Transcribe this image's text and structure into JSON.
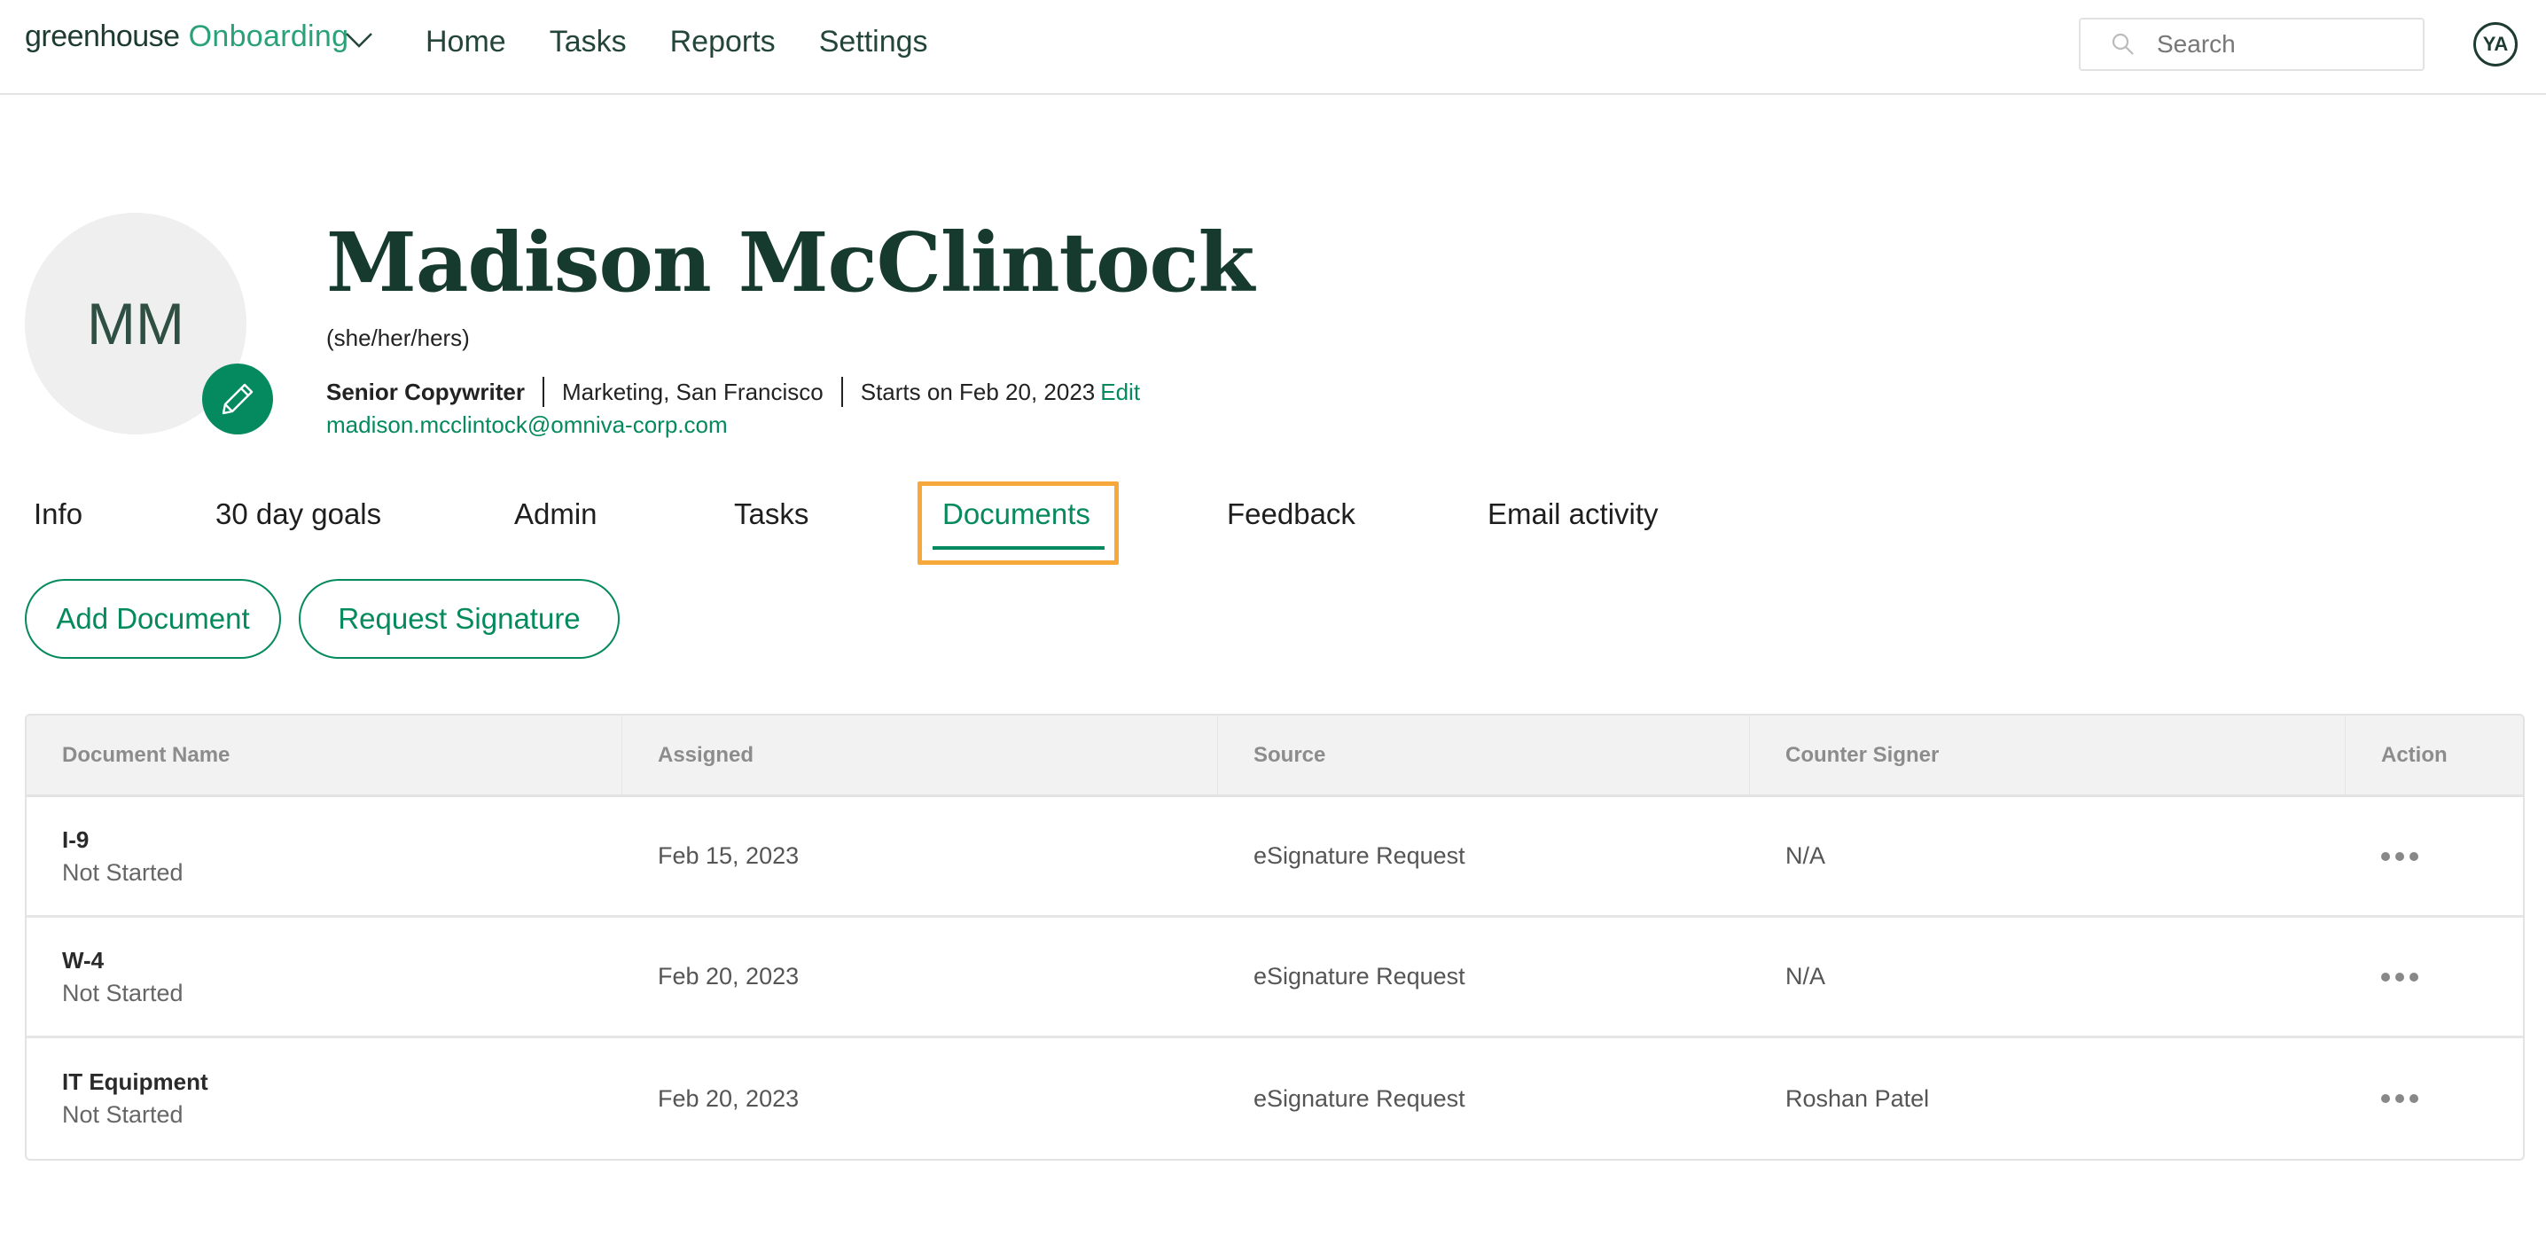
{
  "app": {
    "brand_primary": "greenhouse",
    "brand_secondary": "Onboarding",
    "brand_color": "#2aa178",
    "accent_color": "#048a5e",
    "highlight_color": "#f6a83a"
  },
  "nav": {
    "links": [
      "Home",
      "Tasks",
      "Reports",
      "Settings"
    ],
    "search_placeholder": "Search",
    "search_icon": "search-icon",
    "user_initials": "YA"
  },
  "profile": {
    "initials": "MM",
    "name": "Madison McClintock",
    "pronouns": "(she/her/hers)",
    "job_title": "Senior Copywriter",
    "department_location": "Marketing, San Francisco",
    "start_date": "Starts on Feb 20, 2023",
    "edit_label": "Edit",
    "email": "madison.mcclintock@omniva-corp.com",
    "edit_icon": "pencil-icon"
  },
  "tabs": [
    {
      "label": "Info",
      "active": false
    },
    {
      "label": "30 day goals",
      "active": false
    },
    {
      "label": "Admin",
      "active": false
    },
    {
      "label": "Tasks",
      "active": false
    },
    {
      "label": "Documents",
      "active": true
    },
    {
      "label": "Feedback",
      "active": false
    },
    {
      "label": "Email activity",
      "active": false
    }
  ],
  "actions": {
    "add_document": "Add Document",
    "request_signature": "Request Signature"
  },
  "table": {
    "columns": [
      "Document Name",
      "Assigned",
      "Source",
      "Counter Signer",
      "Action"
    ],
    "rows": [
      {
        "name": "I-9",
        "status": "Not Started",
        "assigned": "Feb 15, 2023",
        "source": "eSignature Request",
        "counter_signer": "N/A"
      },
      {
        "name": "W-4",
        "status": "Not Started",
        "assigned": "Feb 20, 2023",
        "source": "eSignature Request",
        "counter_signer": "N/A"
      },
      {
        "name": "IT Equipment",
        "status": "Not Started",
        "assigned": "Feb 20, 2023",
        "source": "eSignature Request",
        "counter_signer": "Roshan Patel"
      }
    ]
  }
}
